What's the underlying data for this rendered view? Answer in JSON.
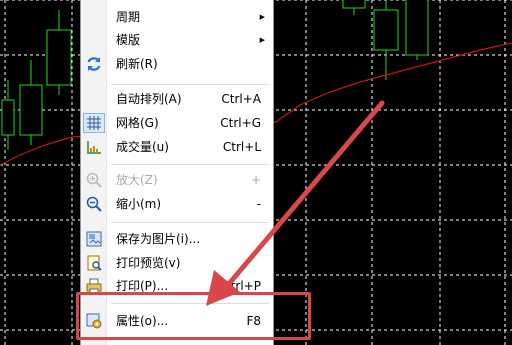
{
  "colors": {
    "grid": "#ffffff",
    "bull": "#26d026",
    "ma": "#c8121a",
    "annot": "#d8484a"
  },
  "menu": {
    "items": [
      {
        "id": "period",
        "label": "周期",
        "submenu": true
      },
      {
        "id": "template",
        "label": "模版",
        "submenu": true
      },
      {
        "id": "refresh",
        "label": "刷新(R)",
        "icon": "refresh-icon"
      },
      {
        "id": "auto-arrange",
        "label": "自动排列(A)",
        "shortcut": "Ctrl+A"
      },
      {
        "id": "grid",
        "label": "网格(G)",
        "shortcut": "Ctrl+G",
        "icon": "grid-icon",
        "checked": true
      },
      {
        "id": "volume",
        "label": "成交量(u)",
        "shortcut": "Ctrl+L",
        "icon": "volume-icon"
      },
      {
        "id": "zoom-in",
        "label": "放大(Z)",
        "shortcut": "+",
        "icon": "zoom-in-icon",
        "disabled": true
      },
      {
        "id": "zoom-out",
        "label": "缩小(m)",
        "shortcut": "-",
        "icon": "zoom-out-icon"
      },
      {
        "id": "save-picture",
        "label": "保存为图片(i)...",
        "icon": "save-picture-icon"
      },
      {
        "id": "print-preview",
        "label": "打印预览(v)",
        "icon": "print-preview-icon"
      },
      {
        "id": "print",
        "label": "打印(P)...",
        "shortcut": "Ctrl+P",
        "icon": "printer-icon"
      },
      {
        "id": "properties",
        "label": "属性(o)...",
        "shortcut": "F8",
        "icon": "properties-icon"
      }
    ]
  }
}
